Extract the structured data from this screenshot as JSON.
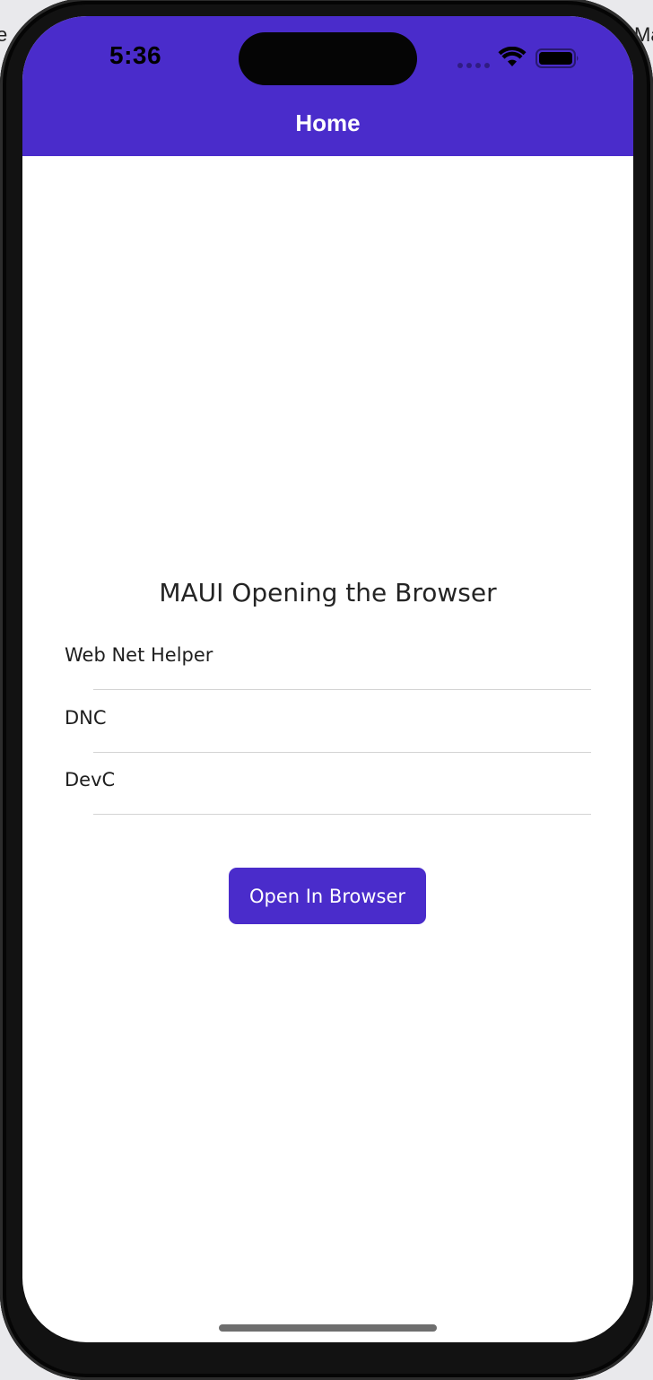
{
  "backdrop": {
    "left_edge_text": "e",
    "right_edge_text": "Ma"
  },
  "status_bar": {
    "time": "5:36",
    "icons": [
      "signal-dots-icon",
      "wifi-icon",
      "battery-icon"
    ]
  },
  "nav": {
    "title": "Home"
  },
  "main": {
    "title": "MAUI Opening the Browser",
    "entries": [
      {
        "value": "Web Net Helper"
      },
      {
        "value": "DNC"
      },
      {
        "value": "DevC"
      }
    ],
    "open_button_label": "Open In Browser"
  },
  "colors": {
    "accent": "#4a2ccb",
    "background": "#ffffff",
    "text": "#242424",
    "divider": "#d4d4d4"
  }
}
